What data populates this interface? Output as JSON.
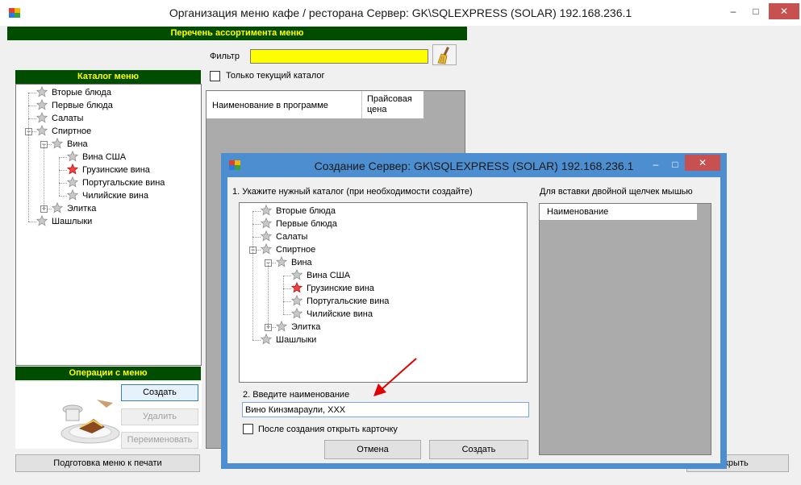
{
  "main": {
    "title": "Организация меню кафе / ресторана  Сервер: GK\\SQLEXPRESS (SOLAR) 192.168.236.1",
    "assortment_header": "Перечень ассортимента меню",
    "filter_label": "Фильтр",
    "filter_value": "",
    "only_current_label": "Только текущий каталог",
    "catalog_header": "Каталог меню",
    "grid_col_name": "Наименование в программе",
    "grid_col_price": "Прайсовая цена",
    "ops_header": "Операции с меню",
    "btn_create": "Создать",
    "btn_delete": "Удалить",
    "btn_rename": "Переименовать",
    "btn_print": "Подготовка меню к печати",
    "btn_close_partial": "акрыть"
  },
  "tree": [
    {
      "label": "Вторые блюда",
      "level": 0,
      "icon": "gray-star-icon"
    },
    {
      "label": "Первые блюда",
      "level": 0,
      "icon": "gray-star-icon"
    },
    {
      "label": "Салаты",
      "level": 0,
      "icon": "gray-star-icon"
    },
    {
      "label": "Спиртное",
      "level": 0,
      "icon": "gray-star-icon",
      "expander": "minus"
    },
    {
      "label": "Вина",
      "level": 1,
      "icon": "gray-star-icon",
      "expander": "minus"
    },
    {
      "label": "Вина США",
      "level": 2,
      "icon": "gray-star-icon"
    },
    {
      "label": "Грузинские вина",
      "level": 2,
      "icon": "red-star-icon",
      "selected": true
    },
    {
      "label": "Португальские вина",
      "level": 2,
      "icon": "gray-star-icon"
    },
    {
      "label": "Чилийские вина",
      "level": 2,
      "icon": "gray-star-icon"
    },
    {
      "label": "Элитка",
      "level": 1,
      "icon": "gray-star-icon",
      "expander": "plus"
    },
    {
      "label": "Шашлыки",
      "level": 0,
      "icon": "gray-star-icon"
    }
  ],
  "dialog": {
    "title": "Создание  Сервер: GK\\SQLEXPRESS (SOLAR) 192.168.236.1",
    "step1_label": "1. Укажите нужный каталог (при необходимости создайте)",
    "hint_label": "Для вставки двойной щелчек мышью",
    "list_col_name": "Наименование",
    "step2_label": "2. Введите наименование",
    "name_value": "Вино Кинзмараули, ХХХ",
    "open_card_label": "После создания открыть карточку",
    "btn_cancel": "Отмена",
    "btn_create": "Создать"
  },
  "colors": {
    "green_header": "#004d00",
    "header_text": "#ffff00",
    "filter_bg": "#ffff00",
    "dialog_border": "#4c8ed0",
    "arrow": "#e00000"
  }
}
